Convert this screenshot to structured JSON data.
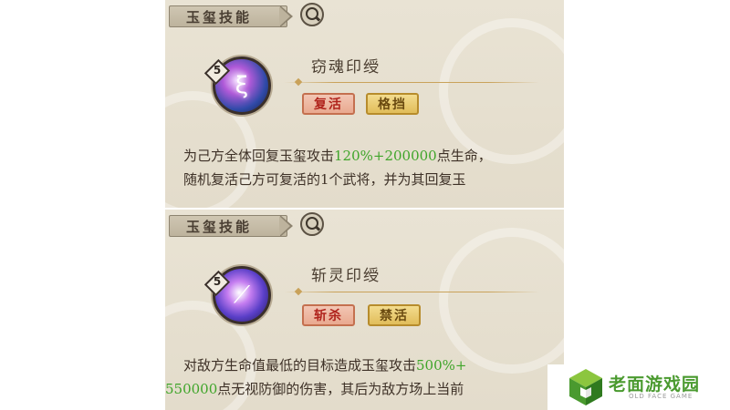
{
  "skills": [
    {
      "tab_label": "玉玺技能",
      "level": "5",
      "name": "窃魂印绶",
      "tags": [
        "复活",
        "格挡"
      ],
      "desc_line1_pre": "为己方全体回复玉玺攻击",
      "desc_line1_hl": "120%+200000",
      "desc_line1_post": "点生命，",
      "desc_line2": "随机复活己方可复活的1个武将，并为其回复玉"
    },
    {
      "tab_label": "玉玺技能",
      "level": "5",
      "name": "斩灵印绶",
      "tags": [
        "斩杀",
        "禁活"
      ],
      "desc_line1_pre": "对敌方生命值最低的目标造成玉玺攻击",
      "desc_line1_hl": "500%+",
      "desc_line2_hl": "550000",
      "desc_line2_post": "点无视防御的伤害，其后为敌方场上当前"
    }
  ],
  "watermark": {
    "brand": "老面游戏园",
    "sub": "OLD FACE GAME"
  },
  "colors": {
    "highlight": "#3fa52a",
    "brand_green": "#4a9a2f"
  }
}
